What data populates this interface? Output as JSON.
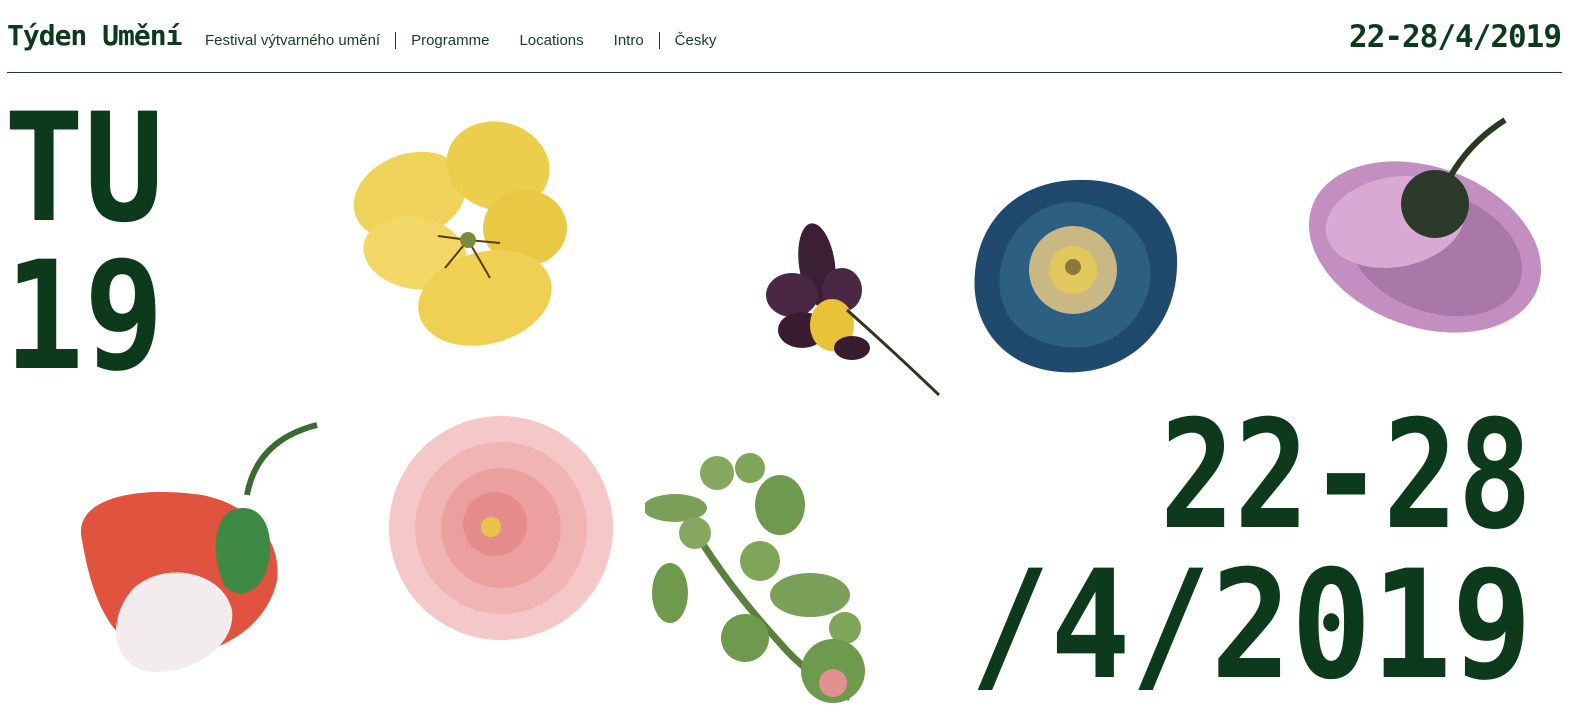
{
  "header": {
    "brand": "Týden Umění",
    "nav": [
      {
        "label": "Festival výtvarného umění"
      },
      {
        "label": "Programme"
      },
      {
        "label": "Locations"
      },
      {
        "label": "Intro"
      },
      {
        "label": "Česky"
      }
    ],
    "date": "22-28/4/2019"
  },
  "hero": {
    "logo_lines": [
      "TU",
      "19"
    ],
    "date_lines": [
      "22-28",
      "/4/2019"
    ]
  },
  "images": [
    {
      "name": "yellow-pansy"
    },
    {
      "name": "purple-violet"
    },
    {
      "name": "blue-morning-glory"
    },
    {
      "name": "pink-carnation"
    },
    {
      "name": "red-white-flower"
    },
    {
      "name": "pink-camellia"
    },
    {
      "name": "green-buds-branch"
    }
  ],
  "colors": {
    "brand_green": "#0c3a1a",
    "background": "#ffffff"
  }
}
